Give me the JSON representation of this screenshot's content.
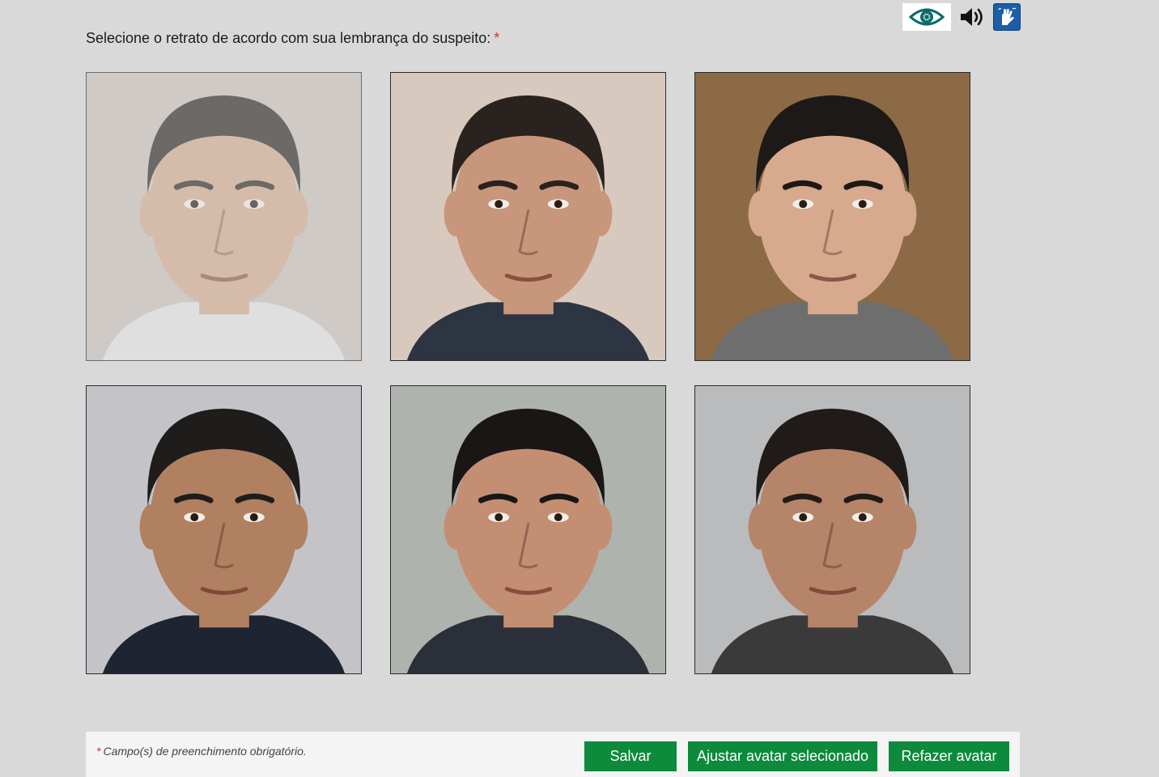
{
  "accessibility": {
    "eye_icon": "eye-icon",
    "audio_icon": "speaker-icon",
    "sign_language_icon": "sign-language-icon"
  },
  "prompt": {
    "text": "Selecione o retrato de acordo com sua lembrança do suspeito:",
    "required_mark": "*"
  },
  "portraits": [
    {
      "state": "faded",
      "bg": "#c9c2bb",
      "skin": "#d2aa8e",
      "hair": "#2a2522",
      "shirt": "#e4e4e4"
    },
    {
      "state": "normal",
      "bg": "#d8c9bf",
      "skin": "#c8967a",
      "hair": "#2a221e",
      "shirt": "#2d3442"
    },
    {
      "state": "normal",
      "bg": "#8b6a45",
      "skin": "#d7a98d",
      "hair": "#1d1916",
      "shirt": "#6e6e6e"
    },
    {
      "state": "normal",
      "bg": "#c4c4c8",
      "skin": "#b08060",
      "hair": "#1f1c1c",
      "shirt": "#1f2433"
    },
    {
      "state": "normal",
      "bg": "#aeb3ae",
      "skin": "#c48e73",
      "hair": "#191615",
      "shirt": "#2b2f3a"
    },
    {
      "state": "normal",
      "bg": "#b9bbbd",
      "skin": "#b68468",
      "hair": "#201b18",
      "shirt": "#3a3a3a"
    }
  ],
  "footer": {
    "required_mark": "*",
    "note": "Campo(s) de preenchimento obrigatório.",
    "save_label": "Salvar",
    "adjust_label": "Ajustar avatar selecionado",
    "redo_label": "Refazer avatar"
  },
  "colors": {
    "primary_button": "#0d8a3c",
    "required": "#d0312d",
    "libras_blue": "#1c5ea8",
    "eye_teal": "#0b6b66"
  }
}
